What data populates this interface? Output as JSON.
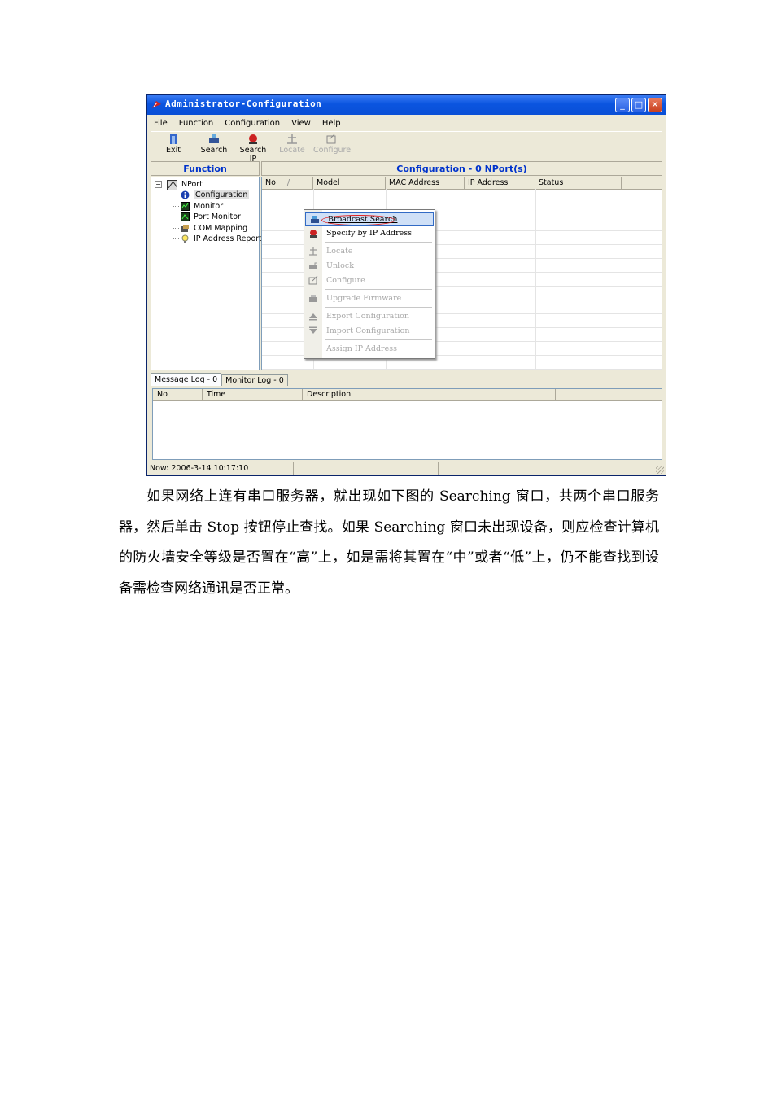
{
  "window": {
    "title": "Administrator-Configuration",
    "menu": [
      "File",
      "Function",
      "Configuration",
      "View",
      "Help"
    ],
    "toolbar": [
      {
        "label": "Exit",
        "icon": "exit-icon",
        "enabled": true
      },
      {
        "label": "Search",
        "icon": "search-icon",
        "enabled": true
      },
      {
        "label": "Search IP",
        "icon": "search-ip-icon",
        "enabled": true
      },
      {
        "label": "Locate",
        "icon": "locate-icon",
        "enabled": false
      },
      {
        "label": "Configure",
        "icon": "configure-icon",
        "enabled": false
      }
    ],
    "function_header": "Function",
    "config_header": "Configuration - 0 NPort(s)",
    "tree": {
      "root": "NPort",
      "children": [
        "Configuration",
        "Monitor",
        "Port Monitor",
        "COM Mapping",
        "IP Address Report"
      ]
    },
    "grid_columns": [
      "No",
      "Model",
      "MAC Address",
      "IP Address",
      "Status"
    ],
    "context_menu": [
      {
        "label": "Broadcast Search",
        "enabled": true,
        "icon": "broadcast-icon"
      },
      {
        "label": "Specify by IP Address",
        "enabled": true,
        "icon": "ip-icon"
      },
      {
        "label": "Locate",
        "enabled": false,
        "icon": "locate-icon"
      },
      {
        "label": "Unlock",
        "enabled": false,
        "icon": "unlock-icon"
      },
      {
        "label": "Configure",
        "enabled": false,
        "icon": "configure-icon"
      },
      {
        "label": "Upgrade Firmware",
        "enabled": false,
        "icon": "firmware-icon"
      },
      {
        "label": "Export Configuration",
        "enabled": false,
        "icon": "export-icon"
      },
      {
        "label": "Import Configuration",
        "enabled": false,
        "icon": "import-icon"
      },
      {
        "label": "Assign IP Address",
        "enabled": false,
        "icon": "assign-icon"
      }
    ],
    "tabs": [
      "Message Log - 0",
      "Monitor Log - 0"
    ],
    "log_columns": [
      "No",
      "Time",
      "Description"
    ],
    "status_text": "Now: 2006-3-14 10:17:10"
  },
  "paragraph": "如果网络上连有串口服务器，就出现如下图的 Searching 窗口，共两个串口服务器，然后单击 Stop 按钮停止查找。如果 Searching 窗口未出现设备，则应检查计算机的防火墙安全等级是否置在“高”上，如是需将其置在“中”或者“低”上，仍不能查找到设备需检查网络通讯是否正常。"
}
